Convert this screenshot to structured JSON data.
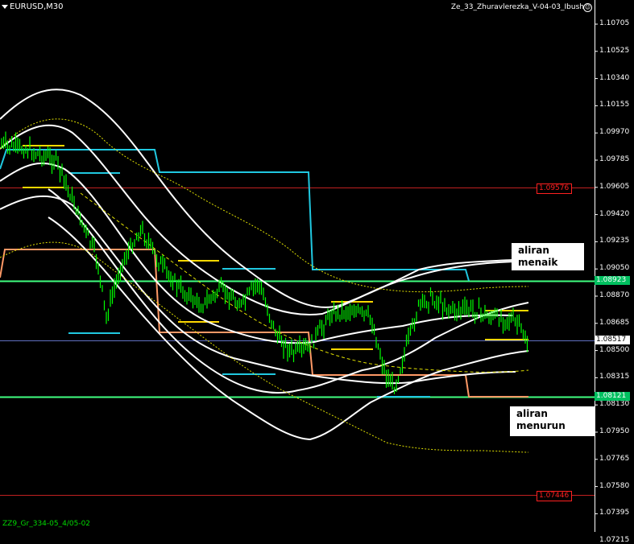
{
  "chart": {
    "symbol_title": "EURUSD,M30",
    "indicator_title": "Ze_33_Zhuravlerezka_V-04-03_Ibush",
    "bottom_text": "ZZ9_Gr_334-05_4/05-02"
  },
  "price_scale": [
    "1.10705",
    "1.10525",
    "1.10340",
    "1.10155",
    "1.09970",
    "1.09785",
    "1.09605",
    "1.09420",
    "1.09235",
    "1.09050",
    "1.08870",
    "1.08685",
    "1.08500",
    "1.08315",
    "1.08130",
    "1.07950",
    "1.07765",
    "1.07580",
    "1.07395",
    "1.07215"
  ],
  "levels": {
    "red_top": "1.09576",
    "green_top": "1.08923",
    "current": "1.08517",
    "green_bottom": "1.08121",
    "red_bottom": "1.07446"
  },
  "annotations": {
    "uptrend_line1": "aliran",
    "uptrend_line2": "menaik",
    "downtrend_line1": "aliran",
    "downtrend_line2": "menurun"
  },
  "colors": {
    "background": "#000000",
    "candles": "#00ff00",
    "bands": "#ffffff",
    "dotted": "#ffff00",
    "cyan": "#20c8e0",
    "orange": "#ff9966",
    "green_level": "#40ff80",
    "red_level": "#c02020"
  }
}
